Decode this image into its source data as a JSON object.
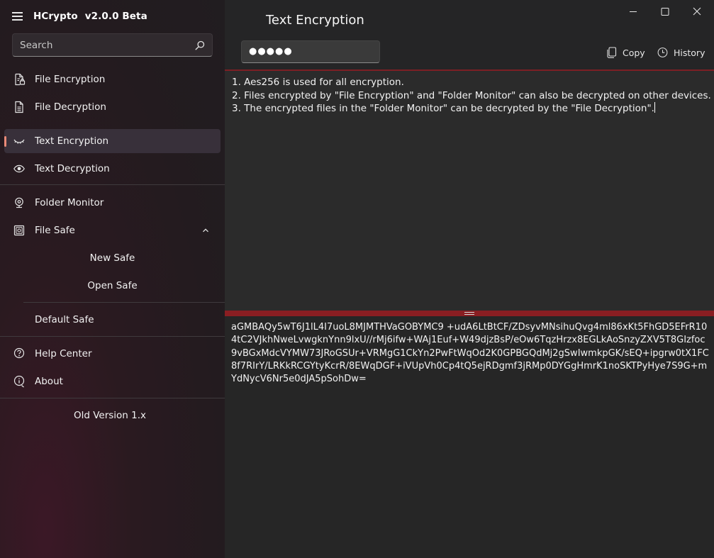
{
  "app": {
    "name": "HCrypto",
    "version": "v2.0.0 Beta"
  },
  "search": {
    "placeholder": "Search"
  },
  "sidebar": {
    "items": [
      {
        "label": "File Encryption",
        "icon": "file-lock-icon"
      },
      {
        "label": "File Decryption",
        "icon": "file-icon"
      },
      {
        "label": "Text Encryption",
        "icon": "eye-closed-icon",
        "selected": true
      },
      {
        "label": "Text Decryption",
        "icon": "eye-icon"
      },
      {
        "label": "Folder Monitor",
        "icon": "webcam-icon"
      },
      {
        "label": "File Safe",
        "icon": "safe-icon",
        "expanded": true
      },
      {
        "label": "Default Safe"
      },
      {
        "label": "Help Center",
        "icon": "question-icon"
      },
      {
        "label": "About",
        "icon": "info-icon"
      }
    ],
    "file_safe_children": [
      "New Safe",
      "Open Safe"
    ],
    "footer_link": "Old Version 1.x"
  },
  "main": {
    "title": "Text Encryption",
    "password_mask": "●●●●●",
    "toolbar": {
      "copy_label": "Copy",
      "history_label": "History"
    },
    "input_lines": [
      "1. Aes256 is used for all encryption.",
      "2. Files encrypted by \"File Encryption\" and \"Folder Monitor\" can also be decrypted on other devices.",
      "3. The encrypted files in the \"Folder Monitor\" can be decrypted by the \"File Decryption\"."
    ],
    "output_text": "aGMBAQy5wT6J1lL4I7uoL8MJMTHVaGOBYMC9 +udA6LtBtCF/ZDsyvMNsihuQvg4ml86xKt5FhGD5EFrR104tC2VJkhNweLvwgknYnn9lxU//rMj6ifw+WAj1Euf+W49djzBsP/eOw6TqzHrzx8EGLkAoSnzyZXV5T8GIzfoc9vBGxMdcVYMW73JRoGSUr+VRMgG1CkYn2PwFtWqOd2K0GPBGQdMj2gSwIwmkpGK/sEQ+ipgrw0tX1FC8f7RIrY/LRKkRCGYtyKcrR/8EWqDGF+iVUpVh0Cp4tQ5ejRDgmf3jRMp0DYGgHmrK1noSKTPyHye7S9G+mYdNycV6Nr5e0dJA5pSohDw="
  },
  "colors": {
    "accent": "#e98a78",
    "splitter": "#8a1e22"
  }
}
